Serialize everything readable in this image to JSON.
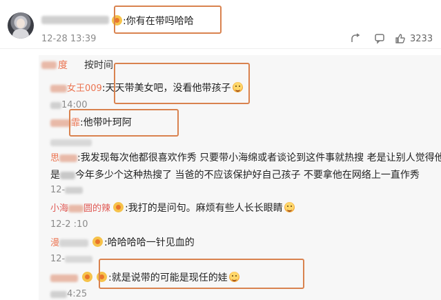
{
  "post": {
    "comment_text": ":你有在带吗哈哈",
    "timestamp": "12-28 13:39",
    "like_count": "3233"
  },
  "reply_header": {
    "author_suffix": "度",
    "sort_label": "按时间"
  },
  "replies": [
    {
      "name_visible": "女王009",
      "text": ":天天带美女吧，没看他带孩子",
      "time": ""
    },
    {
      "time": "14:00"
    },
    {
      "name_visible": "霏",
      "text": ":他带叶珂阿"
    },
    {
      "name_visible": "思",
      "text_line1": ":我发现每次他都很喜欢作秀 只要带小海绵或者谈论到这件事就热搜 老是让别人觉得他",
      "text_line2": "今年多少个这种热搜了 当爸的不应该保护好自己孩子 不要拿他在网络上一直作秀",
      "name_line2_prefix": "是",
      "time": "12-"
    },
    {
      "name_visible_a": "小海",
      "name_visible_b": "圆的辣",
      "text": ":我打的是问句。麻烦有些人长长眼睛",
      "time": "12-2 :10"
    },
    {
      "name_visible": "漫",
      "text": ":哈哈哈哈一针见血的",
      "time": "12-"
    },
    {
      "text": ":就是说带的可能是现任的娃",
      "time": "4:25"
    }
  ]
}
